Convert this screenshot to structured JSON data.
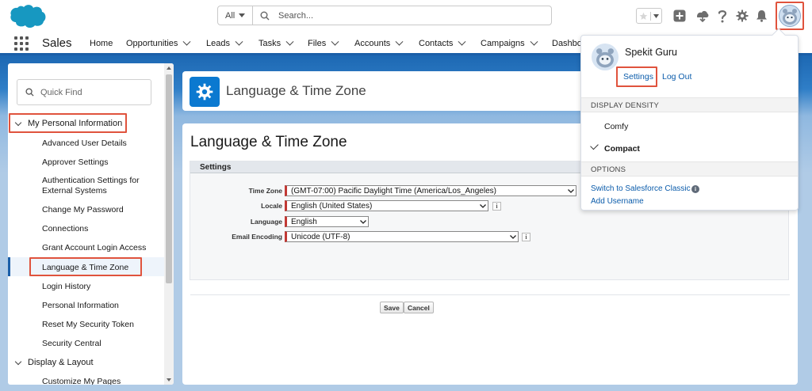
{
  "header": {
    "search_scope": "All",
    "search_placeholder": "Search..."
  },
  "nav": {
    "app_name": "Sales",
    "items": [
      {
        "label": "Home",
        "has_menu": false
      },
      {
        "label": "Opportunities",
        "has_menu": true
      },
      {
        "label": "Leads",
        "has_menu": true
      },
      {
        "label": "Tasks",
        "has_menu": true
      },
      {
        "label": "Files",
        "has_menu": true
      },
      {
        "label": "Accounts",
        "has_menu": true
      },
      {
        "label": "Contacts",
        "has_menu": true
      },
      {
        "label": "Campaigns",
        "has_menu": true
      },
      {
        "label": "Dashbo",
        "has_menu": false
      }
    ]
  },
  "sidebar": {
    "quickfind_placeholder": "Quick Find",
    "section_personal": "My Personal Information",
    "items": [
      "Advanced User Details",
      "Approver Settings",
      "Authentication Settings for External Systems",
      "Change My Password",
      "Connections",
      "Grant Account Login Access",
      "Language & Time Zone",
      "Login History",
      "Personal Information",
      "Reset My Security Token",
      "Security Central"
    ],
    "active_item": "Language & Time Zone",
    "section_display": "Display & Layout",
    "partial_item": "Customize My Pages"
  },
  "page_header": {
    "title": "Language & Time Zone"
  },
  "content": {
    "title": "Language & Time Zone",
    "block_title": "Settings",
    "fields": {
      "time_zone": {
        "label": "Time Zone",
        "value": "(GMT-07:00) Pacific Daylight Time (America/Los_Angeles)"
      },
      "locale": {
        "label": "Locale",
        "value": "English (United States)"
      },
      "language": {
        "label": "Language",
        "value": "English"
      },
      "email_encoding": {
        "label": "Email Encoding",
        "value": "Unicode (UTF-8)"
      }
    },
    "info_glyph": "i",
    "save_label": "Save",
    "cancel_label": "Cancel"
  },
  "profile_menu": {
    "user_name": "Spekit Guru",
    "settings_label": "Settings",
    "logout_label": "Log Out",
    "density_heading": "DISPLAY DENSITY",
    "density_options": [
      "Comfy",
      "Compact"
    ],
    "density_selected": "Compact",
    "options_heading": "OPTIONS",
    "switch_classic_label": "Switch to Salesforce Classic",
    "add_username_label": "Add Username",
    "info_glyph": "i"
  },
  "colors": {
    "brand_blue": "#0b5cab",
    "highlight_red": "#e0533d",
    "required_red": "#c23934",
    "nav_underline": "#1b5fa8"
  },
  "icons": [
    "salesforce-cloud-icon",
    "search-icon",
    "star-icon",
    "add-icon",
    "trailhead-icon",
    "help-icon",
    "setup-gear-icon",
    "bell-icon",
    "avatar-icon",
    "app-launcher-icon",
    "gear-icon",
    "checkmark-icon",
    "info-icon"
  ]
}
